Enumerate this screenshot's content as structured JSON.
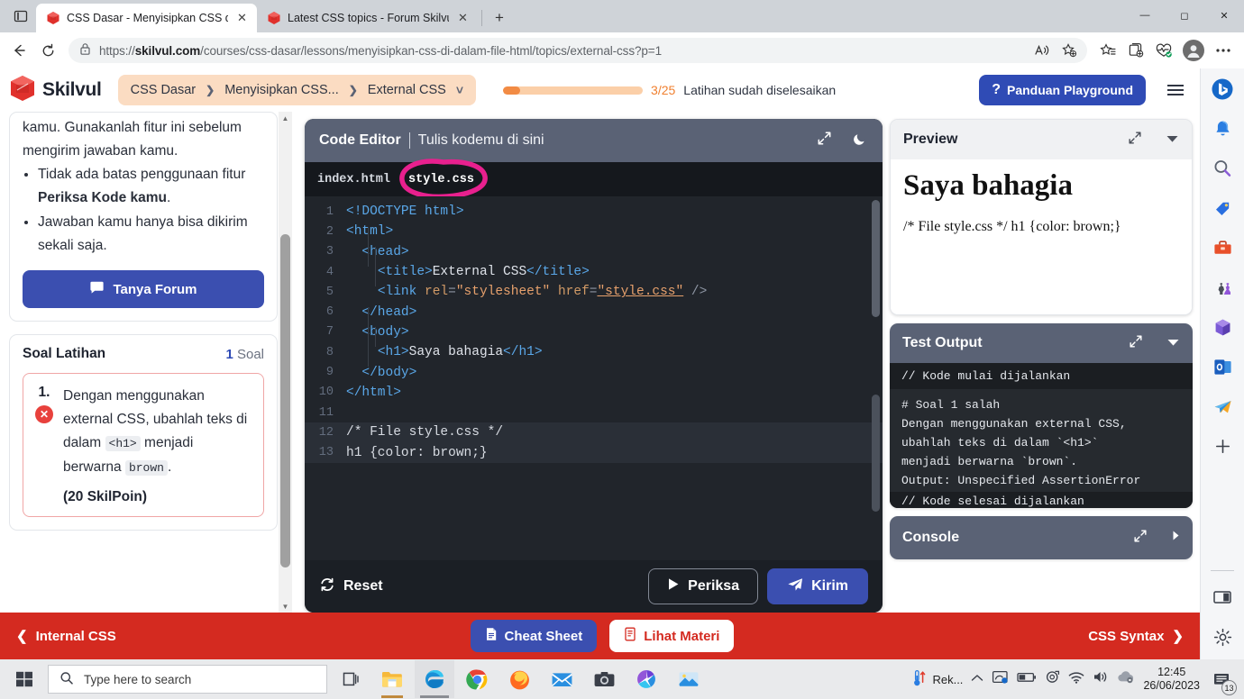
{
  "browser": {
    "tabs": [
      {
        "title": "CSS Dasar - Menyisipkan CSS di",
        "favicon": "skilvul-icon",
        "active": true
      },
      {
        "title": "Latest CSS topics - Forum Skilvul",
        "favicon": "skilvul-icon",
        "active": false
      }
    ],
    "new_tab_label": "+",
    "window_controls": {
      "minimize": "—",
      "maximize": "☐",
      "close": "✕"
    },
    "url": "https://skilvul.com/courses/css-dasar/lessons/menyisipkan-css-di-dalam-file-html/topics/external-css?p=1",
    "url_domain": "skilvul.com",
    "url_scheme": "https://",
    "url_path": "/courses/css-dasar/lessons/menyisipkan-css-di-dalam-file-html/topics/external-css?p=1",
    "icons": {
      "back": "back-arrow-icon",
      "reload": "reload-icon",
      "lock": "lock-icon",
      "read_aloud": "read-aloud-icon",
      "add_favorite": "add-favorite-icon",
      "favorites": "favorites-icon",
      "collections": "collections-icon",
      "browser_essentials": "browser-essentials-icon",
      "profile": "profile-avatar-icon",
      "settings_more": "more-options-icon",
      "tab_actions": "tab-actions-icon"
    }
  },
  "app": {
    "brand": "Skilvul",
    "breadcrumb": [
      {
        "label": "CSS Dasar"
      },
      {
        "label": "Menyisipkan CSS..."
      },
      {
        "label": "External CSS"
      }
    ],
    "breadcrumb_separator": "❯",
    "breadcrumb_caret": "⌄",
    "progress": {
      "count": "3/25",
      "text": "Latihan sudah diselesaikan",
      "percent": 12,
      "bar_color": "#f28b44",
      "track_color": "#fbcfa8"
    },
    "guide_button": "Panduan Playground",
    "guide_icon": "question-mark-icon",
    "menu_icon": "hamburger-menu-icon"
  },
  "sidebar": {
    "lesson_notes": {
      "continuation": "kamu. Gunakanlah fitur ini sebelum mengirim jawaban kamu.",
      "bullets": [
        {
          "pre": "Tidak ada batas penggunaan fitur ",
          "bold": "Periksa Kode kamu",
          "post": "."
        },
        {
          "pre": "Jawaban kamu hanya bisa dikirim sekali saja.",
          "bold": "",
          "post": ""
        }
      ]
    },
    "forum_button": "Tanya Forum",
    "forum_icon": "chat-bubble-icon",
    "exercise": {
      "title": "Soal Latihan",
      "count_number": "1",
      "count_label": "Soal",
      "question": {
        "number": "1.",
        "status_icon": "error-x-icon",
        "text_parts": [
          {
            "type": "text",
            "value": "Dengan menggunakan external CSS, ubahlah teks di dalam "
          },
          {
            "type": "code",
            "value": "<h1>"
          },
          {
            "type": "text",
            "value": " menjadi berwarna "
          },
          {
            "type": "code",
            "value": "brown"
          },
          {
            "type": "text",
            "value": "."
          }
        ],
        "points": "(20 SkilPoin)"
      }
    }
  },
  "editor": {
    "title": "Code Editor",
    "subtitle": "Tulis kodemu di sini",
    "expand_icon": "expand-arrows-icon",
    "theme_icon": "moon-icon",
    "tabs": [
      {
        "label": "index.html",
        "selected": false
      },
      {
        "label": "style.css",
        "selected": true
      }
    ],
    "annotation": {
      "type": "hand-drawn-circle",
      "color": "#e8208e",
      "target": "style.css"
    },
    "lines": [
      {
        "n": "1",
        "tokens": [
          {
            "c": "tag",
            "t": "<!DOCTYPE html>"
          }
        ]
      },
      {
        "n": "2",
        "tokens": [
          {
            "c": "tag",
            "t": "<html>"
          }
        ]
      },
      {
        "n": "3",
        "tokens": [
          {
            "c": "plain",
            "t": "  "
          },
          {
            "c": "tag",
            "t": "<head>"
          }
        ]
      },
      {
        "n": "4",
        "tokens": [
          {
            "c": "plain",
            "t": "    "
          },
          {
            "c": "tag",
            "t": "<title>"
          },
          {
            "c": "txt",
            "t": "External CSS"
          },
          {
            "c": "tag",
            "t": "</title>"
          }
        ]
      },
      {
        "n": "5",
        "tokens": [
          {
            "c": "plain",
            "t": "    "
          },
          {
            "c": "tag",
            "t": "<link"
          },
          {
            "c": "plain",
            "t": " "
          },
          {
            "c": "attr",
            "t": "rel"
          },
          {
            "c": "pun",
            "t": "="
          },
          {
            "c": "str",
            "t": "\"stylesheet\""
          },
          {
            "c": "plain",
            "t": " "
          },
          {
            "c": "attr",
            "t": "href"
          },
          {
            "c": "pun",
            "t": "="
          },
          {
            "c": "stru",
            "t": "\"style.css\""
          },
          {
            "c": "plain",
            "t": " "
          },
          {
            "c": "pun",
            "t": "/>"
          }
        ]
      },
      {
        "n": "6",
        "tokens": [
          {
            "c": "plain",
            "t": "  "
          },
          {
            "c": "tag",
            "t": "</head>"
          }
        ]
      },
      {
        "n": "7",
        "tokens": [
          {
            "c": "plain",
            "t": "  "
          },
          {
            "c": "tag",
            "t": "<body>"
          }
        ]
      },
      {
        "n": "8",
        "tokens": [
          {
            "c": "plain",
            "t": "    "
          },
          {
            "c": "tag",
            "t": "<h1>"
          },
          {
            "c": "txt",
            "t": "Saya bahagia"
          },
          {
            "c": "tag",
            "t": "</h1>"
          }
        ]
      },
      {
        "n": "9",
        "tokens": [
          {
            "c": "plain",
            "t": "  "
          },
          {
            "c": "tag",
            "t": "</body>"
          }
        ]
      },
      {
        "n": "10",
        "tokens": [
          {
            "c": "tag",
            "t": "</html>"
          }
        ]
      },
      {
        "n": "11",
        "tokens": [
          {
            "c": "plain",
            "t": ""
          }
        ]
      },
      {
        "n": "12",
        "tokens": [
          {
            "c": "plain",
            "t": "/* File style.css */"
          }
        ],
        "highlight": true
      },
      {
        "n": "13",
        "tokens": [
          {
            "c": "plain",
            "t": "h1 {color: brown;}"
          }
        ],
        "highlight": true
      }
    ],
    "footer": {
      "reset": "Reset",
      "reset_icon": "refresh-icon",
      "check": "Periksa",
      "check_icon": "play-icon",
      "submit": "Kirim",
      "submit_icon": "paper-plane-icon"
    }
  },
  "preview": {
    "title": "Preview",
    "expand_icon": "expand-arrows-icon",
    "collapse_icon": "chevron-down-icon",
    "heading": "Saya bahagia",
    "body_text": "/* File style.css */ h1 {color: brown;}"
  },
  "test_output": {
    "title": "Test Output",
    "expand_icon": "expand-arrows-icon",
    "collapse_icon": "chevron-down-icon",
    "start_line": "// Kode mulai dijalankan",
    "lines": [
      "# Soal 1 salah",
      "Dengan menggunakan external CSS,",
      "ubahlah teks di dalam `<h1>`",
      "menjadi berwarna `brown`.",
      "Output: Unspecified AssertionError"
    ],
    "cut_line": "// Kode selesai dijalankan"
  },
  "console": {
    "title": "Console",
    "expand_icon": "expand-arrows-icon",
    "collapse_icon": "chevron-right-icon"
  },
  "bottom_bar": {
    "prev_label": "Internal CSS",
    "prev_icon": "chevron-left-icon",
    "cheat_sheet": "Cheat Sheet",
    "cheat_icon": "document-icon",
    "materi": "Lihat Materi",
    "materi_icon": "book-icon",
    "next_label": "CSS Syntax",
    "next_icon": "chevron-right-icon",
    "background": "#d42a20"
  },
  "edge_sidebar": {
    "icons": [
      "bing-copilot-icon",
      "notification-bell-icon",
      "search-icon",
      "shopping-tag-icon",
      "tools-toolbox-icon",
      "games-icon",
      "office-icon",
      "outlook-icon",
      "telegram-icon",
      "add-plus-icon"
    ],
    "bottom_icons": [
      "split-screen-icon",
      "settings-gear-icon"
    ]
  },
  "taskbar": {
    "start_icon": "windows-start-icon",
    "search_placeholder": "Type here to search",
    "search_icon": "search-icon",
    "apps": [
      "task-view-icon",
      "file-explorer-icon",
      "edge-icon",
      "chrome-icon",
      "firefox-icon",
      "mail-icon",
      "camera-icon",
      "settings-icon",
      "photos-icon"
    ],
    "tray": {
      "temperature_icon": "temperature-icon",
      "weather_label": "Rek...",
      "chevron_icon": "show-hidden-icons-icon",
      "icons": [
        "onedrive-icon",
        "battery-icon",
        "webcam-icon",
        "wifi-icon",
        "volume-icon",
        "cloud-icon"
      ],
      "time": "12:45",
      "date": "26/06/2023",
      "notification_icon": "notification-icon",
      "notification_count": "13"
    }
  }
}
